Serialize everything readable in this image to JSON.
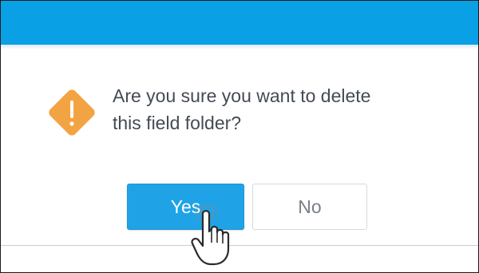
{
  "dialog": {
    "message_line1": "Are you sure you want to delete",
    "message_line2": "this field folder?",
    "yes_label": "Yes",
    "no_label": "No"
  },
  "colors": {
    "header": "#0aa0e6",
    "warning": "#f2a442",
    "primary_button": "#1fa3e6"
  },
  "icons": {
    "warning": "warning-icon",
    "cursor": "hand-pointer-icon"
  }
}
